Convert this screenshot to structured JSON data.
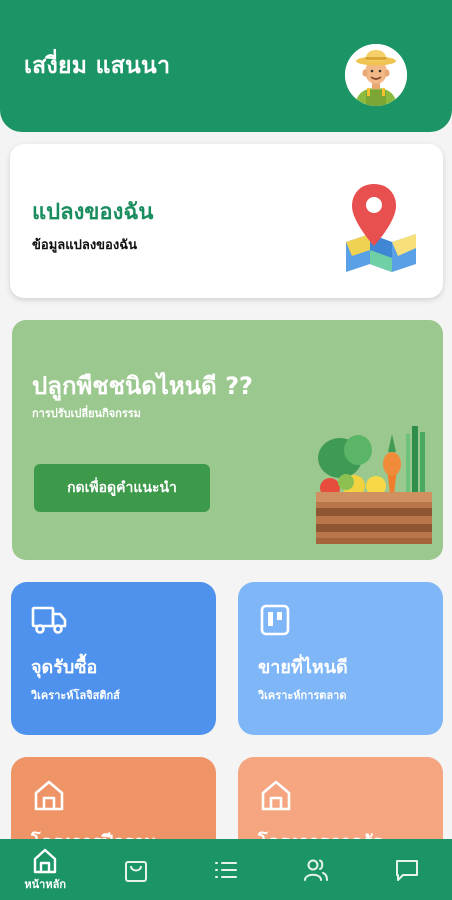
{
  "header": {
    "user_name": "เสงี่ยม แสนนา",
    "avatar_icon": "farmer-avatar-icon"
  },
  "my_plot": {
    "title": "แปลงของฉัน",
    "subtitle": "ข้อมูลแปลงของฉัน",
    "icon": "map-pin-icon"
  },
  "recommend": {
    "title": "ปลูกพืชชนิดไหนดี ??",
    "subtitle": "การปรับเปลี่ยนกิจกรรม",
    "button_label": "กดเพื่อดูคำแนะนำ",
    "icon": "vegetable-crate-icon"
  },
  "tiles": [
    {
      "title": "จุดรับซื้อ",
      "subtitle": "วิเคราะห์โลจิสติกส์",
      "icon": "truck-icon",
      "color": "#4e92ed"
    },
    {
      "title": "ขายที่ไหนดี",
      "subtitle": "วิเคราะห์การตลาด",
      "icon": "board-icon",
      "color": "#7fb6f7"
    },
    {
      "title": "โครงการปีกฐาน",
      "subtitle": "",
      "icon": "home-icon",
      "color": "#ee9466"
    },
    {
      "title": "โครงการภาครัฐ",
      "subtitle": "",
      "icon": "home-icon",
      "color": "#f5a57f"
    }
  ],
  "bottom_nav": {
    "items": [
      {
        "label": "หน้าหลัก",
        "icon": "home-icon",
        "active": true
      },
      {
        "label": "",
        "icon": "shopping-bag-icon"
      },
      {
        "label": "",
        "icon": "list-icon"
      },
      {
        "label": "",
        "icon": "users-icon"
      },
      {
        "label": "",
        "icon": "chat-icon"
      }
    ]
  },
  "colors": {
    "primary": "#1b9566",
    "card_green": "#9bc88f",
    "button_green": "#3d9a4b"
  }
}
